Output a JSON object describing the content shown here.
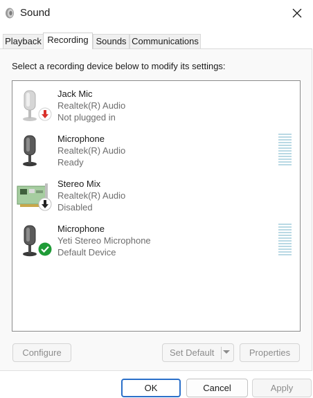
{
  "window": {
    "title": "Sound"
  },
  "tabs": [
    {
      "label": "Playback",
      "active": false
    },
    {
      "label": "Recording",
      "active": true
    },
    {
      "label": "Sounds",
      "active": false
    },
    {
      "label": "Communications",
      "active": false
    }
  ],
  "recording": {
    "instructions": "Select a recording device below to modify its settings:",
    "devices": [
      {
        "name": "Jack Mic",
        "driver": "Realtek(R) Audio",
        "status": "Not plugged in",
        "icon": "microphone-icon",
        "badge": "unplugged-down-arrow-icon",
        "level_meter": false
      },
      {
        "name": "Microphone",
        "driver": "Realtek(R) Audio",
        "status": "Ready",
        "icon": "microphone-icon",
        "badge": "",
        "level_meter": true,
        "level": 0
      },
      {
        "name": "Stereo Mix",
        "driver": "Realtek(R) Audio",
        "status": "Disabled",
        "icon": "sound-card-icon",
        "badge": "disabled-down-arrow-icon",
        "level_meter": false
      },
      {
        "name": "Microphone",
        "driver": "Yeti Stereo Microphone",
        "status": "Default Device",
        "icon": "microphone-icon",
        "badge": "default-checkmark-icon",
        "level_meter": true,
        "level": 0
      }
    ]
  },
  "buttons": {
    "configure": "Configure",
    "set_default": "Set Default",
    "properties": "Properties",
    "ok": "OK",
    "cancel": "Cancel",
    "apply": "Apply"
  },
  "colors": {
    "accent": "#2a6fc9",
    "unplugged_badge": "#d9312b",
    "default_badge": "#1f9b37",
    "meter": "#b9d9e4"
  }
}
